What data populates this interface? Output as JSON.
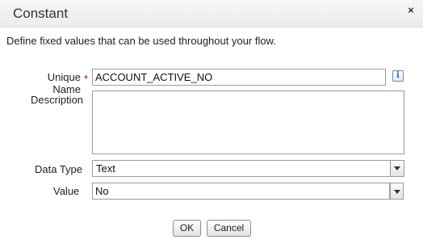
{
  "dialog": {
    "title": "Constant",
    "close_glyph": "×",
    "description": "Define fixed values that can be used throughout your flow."
  },
  "fields": {
    "unique_name": {
      "label": "Unique Name",
      "required_marker": "*",
      "value": "ACCOUNT_ACTIVE_NO",
      "info_glyph": "i"
    },
    "description": {
      "label": "Description",
      "value": ""
    },
    "data_type": {
      "label": "Data Type",
      "value": "Text"
    },
    "value": {
      "label": "Value",
      "value": "No"
    }
  },
  "buttons": {
    "ok": "OK",
    "cancel": "Cancel"
  },
  "icons": {
    "close": "close-icon",
    "info": "info-icon",
    "dropdown": "chevron-down-icon"
  }
}
